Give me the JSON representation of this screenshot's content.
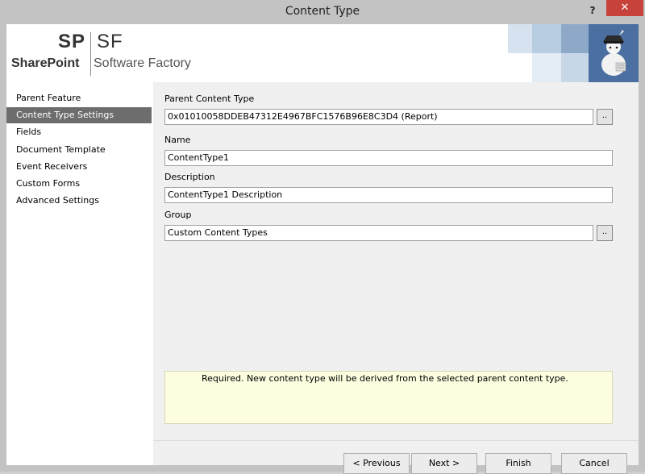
{
  "window": {
    "title": "Content Type",
    "help_label": "?",
    "close_label": "✕"
  },
  "logo": {
    "sp": "SP",
    "sf": "SF",
    "sharepoint": "SharePoint",
    "factory": "Software Factory"
  },
  "nav": {
    "items": [
      {
        "label": "Parent Feature"
      },
      {
        "label": "Content Type Settings",
        "active": true
      },
      {
        "label": "Fields"
      },
      {
        "label": "Document Template"
      },
      {
        "label": "Event Receivers"
      },
      {
        "label": "Custom Forms"
      },
      {
        "label": "Advanced Settings"
      }
    ]
  },
  "form": {
    "parent_content_type": {
      "label": "Parent Content Type",
      "value": "0x01010058DDEB47312E4967BFC1576B96E8C3D4 (Report)",
      "browse_label": ".."
    },
    "name": {
      "label": "Name",
      "value": "ContentType1"
    },
    "description": {
      "label": "Description",
      "value": "ContentType1 Description"
    },
    "group": {
      "label": "Group",
      "value": "Custom Content Types",
      "browse_label": ".."
    }
  },
  "help": {
    "text": "Required. New content type will be derived from the selected parent content type."
  },
  "buttons": {
    "previous": "< Previous",
    "next": "Next >",
    "finish": "Finish",
    "cancel": "Cancel"
  },
  "colors": {
    "accent_blue": "#4a6fa0",
    "active_nav": "#6d6d6d",
    "help_bg": "#fdfde0",
    "close_red": "#c7423a"
  }
}
